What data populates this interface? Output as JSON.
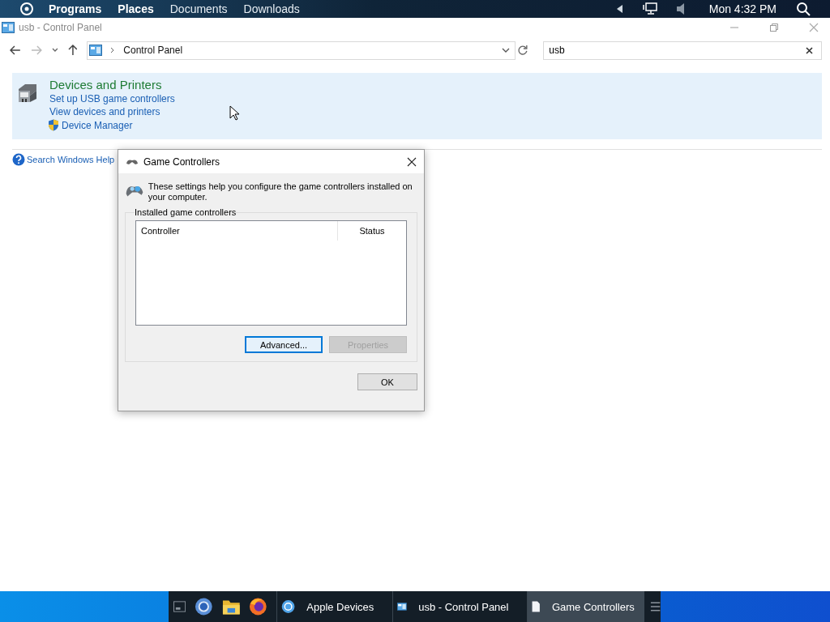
{
  "top_bar": {
    "menu": [
      "Programs",
      "Places",
      "Documents",
      "Downloads"
    ],
    "clock": "Mon 4:32 PM"
  },
  "window": {
    "title": "usb - Control Panel",
    "address": "Control Panel",
    "search_value": "usb"
  },
  "results": {
    "heading": "Devices and Printers",
    "links": [
      {
        "label": "Set up USB game controllers",
        "kind": "plain"
      },
      {
        "label": "View devices and printers",
        "kind": "plain"
      },
      {
        "label": "Device Manager",
        "kind": "shield"
      }
    ]
  },
  "help_link": "Search Windows Help",
  "dialog": {
    "title": "Game Controllers",
    "description": "These settings help you configure the game controllers installed on your computer.",
    "group_label": "Installed game controllers",
    "columns": [
      "Controller",
      "Status"
    ],
    "buttons": [
      {
        "label": "Advanced...",
        "disabled": false,
        "focused": true
      },
      {
        "label": "Properties",
        "disabled": true,
        "focused": false
      }
    ],
    "ok": "OK"
  },
  "taskbar": {
    "items": [
      {
        "label": "Apple Devices",
        "kind": "sync",
        "selected": false
      },
      {
        "label": "usb - Control Panel",
        "kind": "panel",
        "selected": false
      },
      {
        "label": "Game Controllers",
        "kind": "doc",
        "selected": true
      }
    ]
  }
}
